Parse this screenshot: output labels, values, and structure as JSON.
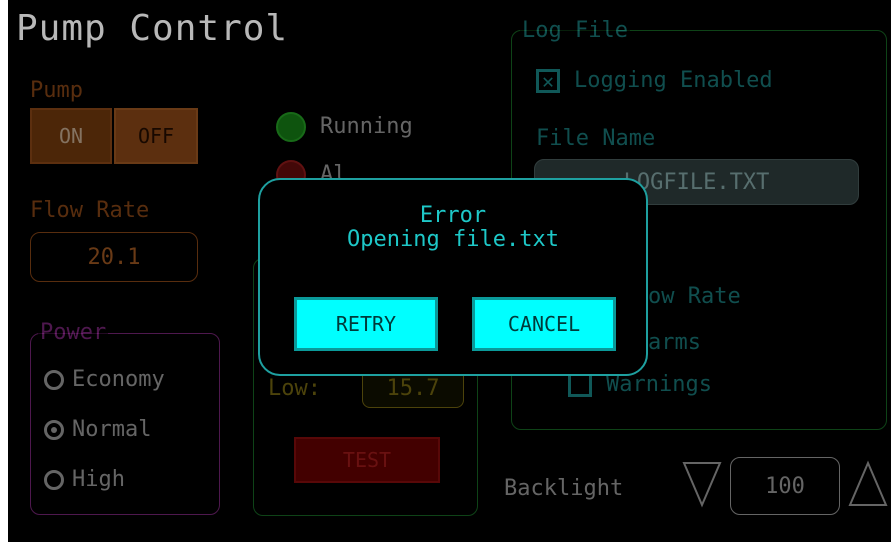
{
  "title": "Pump Control",
  "pump": {
    "label": "Pump",
    "on_label": "ON",
    "off_label": "OFF"
  },
  "flow_rate": {
    "label": "Flow Rate",
    "value": "20.1"
  },
  "power": {
    "legend": "Power",
    "options": [
      {
        "label": "Economy",
        "selected": false
      },
      {
        "label": "Normal",
        "selected": true
      },
      {
        "label": "High",
        "selected": false
      }
    ]
  },
  "status": {
    "running_label": "Running",
    "alarm_label_partial": "Al"
  },
  "alarm": {
    "low_label": "Low:",
    "low_value": "15.7",
    "test_label": "TEST"
  },
  "log_file": {
    "legend": "Log File",
    "logging_enabled_label": "Logging Enabled",
    "logging_enabled_checked": true,
    "file_name_label": "File Name",
    "file_name_value": "LOGFILE.TXT",
    "flow_rate_partial": "ow Rate",
    "alarms_partial": "arms",
    "warnings_label": "Warnings",
    "warnings_checked": false
  },
  "backlight": {
    "label": "Backlight",
    "value": "100",
    "down_icon": "triangle-down-icon",
    "up_icon": "triangle-up-icon"
  },
  "dialog": {
    "title_line1": "Error",
    "title_line2": "Opening file.txt",
    "retry_label": "RETRY",
    "cancel_label": "CANCEL"
  },
  "colors": {
    "pump_orange": "#a8561c",
    "power_purple": "#8e2c8e",
    "group_green": "#1a7a2a",
    "teal": "#1e8e8e",
    "dialog_button": "#00ffff"
  }
}
